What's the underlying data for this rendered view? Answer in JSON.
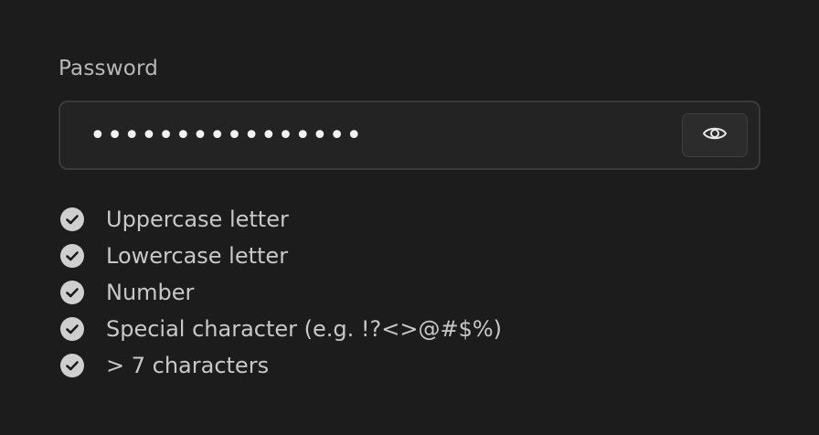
{
  "password_field": {
    "label": "Password",
    "value": "••••••••••••••••",
    "toggle_icon": "eye-icon"
  },
  "requirements": {
    "check_icon": "check-circle-icon",
    "check_color": "#cfcfcf",
    "items": [
      {
        "label": "Uppercase letter",
        "met": true
      },
      {
        "label": "Lowercase letter",
        "met": true
      },
      {
        "label": "Number",
        "met": true
      },
      {
        "label": "Special character (e.g. !?<>@#$%)",
        "met": true
      },
      {
        "label": "> 7 characters",
        "met": true
      }
    ]
  }
}
